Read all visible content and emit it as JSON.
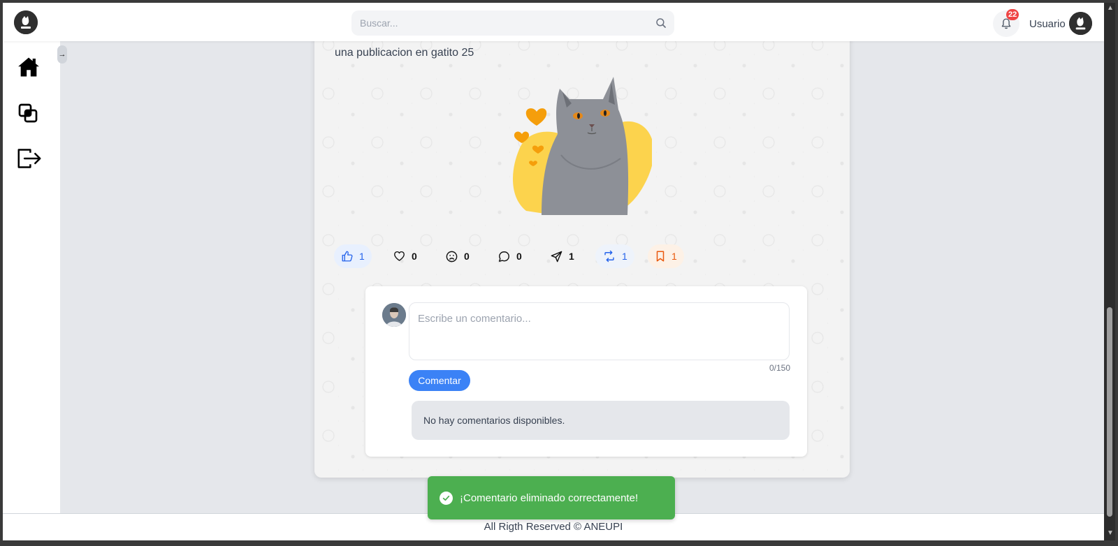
{
  "header": {
    "search_placeholder": "Buscar...",
    "notifications_count": "22",
    "username": "Usuario"
  },
  "sidebar": {
    "items": [
      {
        "icon": "home-icon"
      },
      {
        "icon": "layers-icon"
      },
      {
        "icon": "logout-icon"
      }
    ],
    "collapse_label": "→"
  },
  "post": {
    "text": "una publicacion en gatito 25",
    "reactions": {
      "like": "1",
      "love": "0",
      "sad": "0",
      "comments": "0",
      "share": "1",
      "repost": "1",
      "save": "1"
    }
  },
  "comment_form": {
    "placeholder": "Escribe un comentario...",
    "counter": "0/150",
    "submit_label": "Comentar",
    "empty_message": "No hay comentarios disponibles."
  },
  "toast": {
    "message": "¡Comentario eliminado correctamente!"
  },
  "footer": {
    "text": "All Rigth Reserved © ANEUPI"
  },
  "colors": {
    "accent": "#3b82f6",
    "toast": "#4caf50",
    "badge": "#ef4444",
    "save": "#f97316"
  }
}
